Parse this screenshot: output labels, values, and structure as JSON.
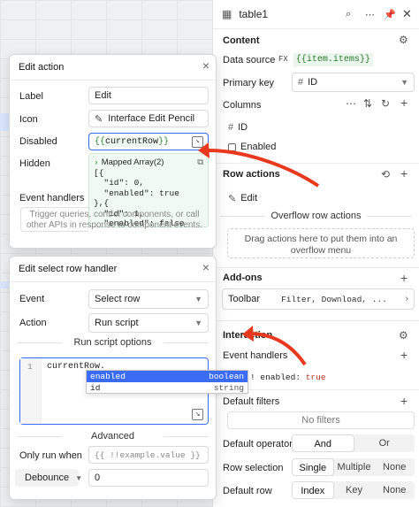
{
  "inspector": {
    "component_name": "table1",
    "content": {
      "title": "Content",
      "data_source_label": "Data source",
      "data_source_fx": "FX",
      "data_source_value": "{{item.items}}",
      "primary_key_label": "Primary key",
      "primary_key_value": "ID",
      "columns_label": "Columns",
      "columns": [
        "ID",
        "Enabled"
      ]
    },
    "row_actions": {
      "title": "Row actions",
      "items": [
        "Edit"
      ],
      "overflow_title": "Overflow row actions",
      "overflow_drop_text": "Drag actions here to put them into an overflow menu"
    },
    "addons": {
      "title": "Add-ons",
      "toolbar_label": "Toolbar",
      "toolbar_value": "Filter, Download, ..."
    },
    "interaction": {
      "title": "Interaction",
      "event_handlers_label": "Event handlers",
      "enabled_prefix": "!",
      "enabled_key": "enabled:",
      "enabled_value": "true"
    },
    "default_filters": {
      "label": "Default filters",
      "empty": "No filters"
    },
    "default_operator": {
      "label": "Default operator",
      "options": [
        "And",
        "Or"
      ],
      "selected": "And"
    },
    "row_selection": {
      "label": "Row selection",
      "options": [
        "Single",
        "Multiple",
        "None"
      ],
      "selected": "Single"
    },
    "default_row": {
      "label": "Default row",
      "options": [
        "Index",
        "Key",
        "None"
      ],
      "selected": "Index"
    }
  },
  "edit_action": {
    "title": "Edit action",
    "label_label": "Label",
    "label_value": "Edit",
    "icon_label": "Icon",
    "icon_value": "Interface Edit Pencil",
    "disabled_label": "Disabled",
    "disabled_value": "currentRow",
    "hidden_label": "Hidden",
    "event_handlers_label": "Event handlers",
    "event_handlers_hint": "Trigger queries, control components, or call other APIs in response to component events.",
    "preview_title": "Mapped Array(2)",
    "preview_lines": [
      "[{",
      "  \"id\": 0,",
      "  \"enabled\": true",
      "},{",
      "  \"id\": 1,",
      "  \"enabled\": false"
    ]
  },
  "select_row_handler": {
    "title": "Edit select row handler",
    "event_label": "Event",
    "event_value": "Select row",
    "action_label": "Action",
    "action_value": "Run script",
    "options_title": "Run script options",
    "line_number": "1",
    "code": "currentRow.",
    "autocomplete": [
      {
        "name": "enabled",
        "type": "boolean",
        "selected": true
      },
      {
        "name": "id",
        "type": "string",
        "selected": false
      }
    ],
    "advanced_title": "Advanced",
    "only_run_when_label": "Only run when",
    "only_run_when_placeholder": "{{ !!example.value }}",
    "debounce_label": "Debounce",
    "debounce_value": "0"
  },
  "colors": {
    "accent": "#3b6cf6",
    "arrow": "#e8391e",
    "code_bg": "#f0faf2"
  }
}
